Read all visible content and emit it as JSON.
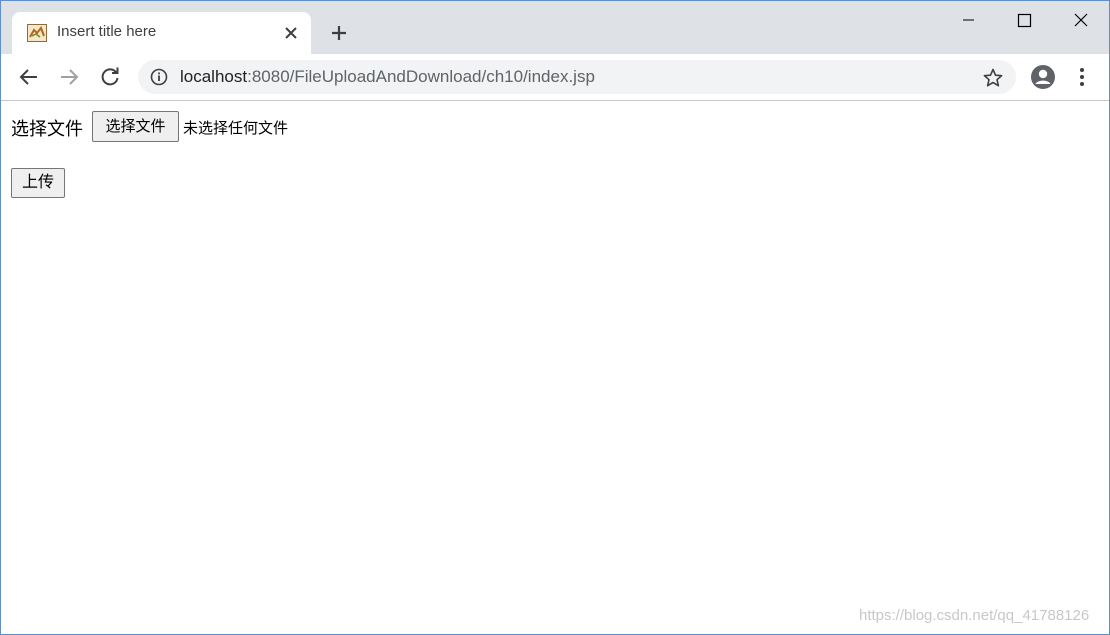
{
  "browser": {
    "tab": {
      "title": "Insert title here",
      "favicon": "tomcat-icon"
    },
    "address_bar": {
      "host": "localhost",
      "path": ":8080/FileUploadAndDownload/ch10/index.jsp"
    },
    "icons": {
      "back": "back-arrow-icon",
      "forward": "forward-arrow-icon",
      "reload": "reload-icon",
      "info": "info-icon",
      "bookmark": "star-icon",
      "profile": "profile-icon",
      "menu": "kebab-menu-icon",
      "new_tab": "plus-icon",
      "close_tab": "close-icon"
    }
  },
  "form": {
    "file_label": "选择文件",
    "choose_button": "选择文件",
    "no_file_text": "未选择任何文件",
    "upload_button": "上传"
  },
  "watermark": "https://blog.csdn.net/qq_41788126",
  "colors": {
    "tabstrip": "#dee1e6",
    "omnibox": "#f1f3f4",
    "window_border": "#5f8fc8"
  }
}
